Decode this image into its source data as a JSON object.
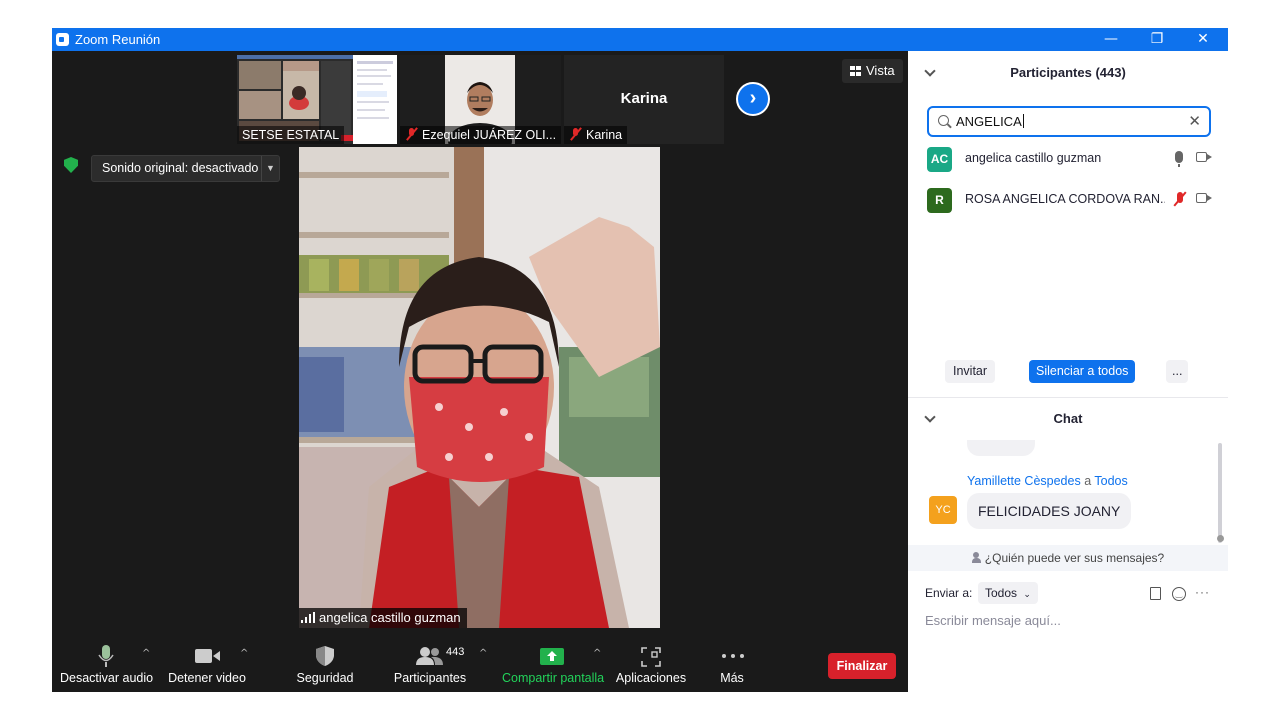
{
  "window": {
    "title": "Zoom Reunión",
    "controls": {
      "minimize": "—",
      "restore": "❐",
      "close": "✕"
    }
  },
  "gallery": {
    "thumbnails": [
      {
        "label": "SETSE ESTATAL",
        "muted": false
      },
      {
        "label": "Ezequiel JUÁREZ OLI...",
        "muted": true
      },
      {
        "label": "Karina",
        "muted": true,
        "center_name": "Karina"
      }
    ],
    "next_icon": "chevron-right-icon",
    "view_button": "Vista"
  },
  "main_video": {
    "sound_option": "Sonido original: desactivado",
    "speaker_name": "angelica castillo guzman"
  },
  "toolbar": {
    "mute": "Desactivar audio",
    "video": "Detener video",
    "security": "Seguridad",
    "participants": "Participantes",
    "participants_count": "443",
    "share": "Compartir pantalla",
    "apps": "Aplicaciones",
    "more": "Más",
    "end": "Finalizar"
  },
  "participants_panel": {
    "title": "Participantes (443)",
    "search_value": "ANGELICA",
    "participants": [
      {
        "initials": "AC",
        "name": "angelica castillo guzman",
        "avatar_color": "#1aa886",
        "muted": false
      },
      {
        "initials": "R",
        "name": "ROSA ANGELICA CORDOVA RAN...",
        "avatar_color": "#2d6a1e",
        "muted": true
      }
    ],
    "invite": "Invitar",
    "mute_all": "Silenciar a todos",
    "more": "..."
  },
  "chat_panel": {
    "title": "Chat",
    "message": {
      "sender": "Yamillette Cèspedes",
      "to_word": "a",
      "recipient": "Todos",
      "initials": "YC",
      "text": "FELICIDADES JOANY"
    },
    "who_can_see": "¿Quién puede ver sus mensajes?",
    "send_to_label": "Enviar a:",
    "send_to_value": "Todos",
    "input_placeholder": "Escribir mensaje aquí..."
  },
  "colors": {
    "brand_blue": "#0e72ed",
    "end_red": "#d8212b",
    "share_green": "#22b14c",
    "muted_red": "#e02828"
  }
}
